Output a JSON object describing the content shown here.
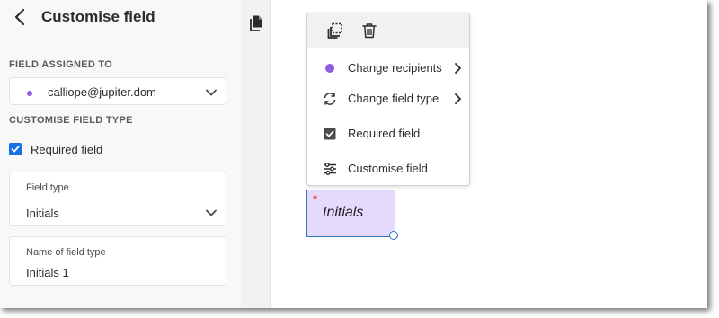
{
  "panel": {
    "title": "Customise field",
    "assigned_heading": "FIELD ASSIGNED TO",
    "assigned_value": "calliope@jupiter.dom",
    "recipient_color": "#8d5ce0",
    "type_heading": "CUSTOMISE FIELD TYPE",
    "required_label": "Required field",
    "required_checked": true,
    "field_type_label": "Field type",
    "field_type_value": "Initials",
    "name_label": "Name of field type",
    "name_value": "Initials 1"
  },
  "menu": {
    "toolbar": [
      "duplicate-icon",
      "trash-icon"
    ],
    "items": [
      {
        "label": "Change recipients",
        "icon": "recipient-dot-icon",
        "submenu": true
      },
      {
        "label": "Change field type",
        "icon": "refresh-icon",
        "submenu": true
      },
      {
        "label": "Required field",
        "icon": "checkbox-icon",
        "submenu": false
      },
      {
        "label": "Customise field",
        "icon": "sliders-icon",
        "submenu": false
      }
    ]
  },
  "field": {
    "text": "Initials",
    "required_marker": "*"
  },
  "colors": {
    "accent": "#1473e6",
    "field_fill": "#e5dafc",
    "field_border": "#2f73c9",
    "required_star": "#e34850"
  }
}
